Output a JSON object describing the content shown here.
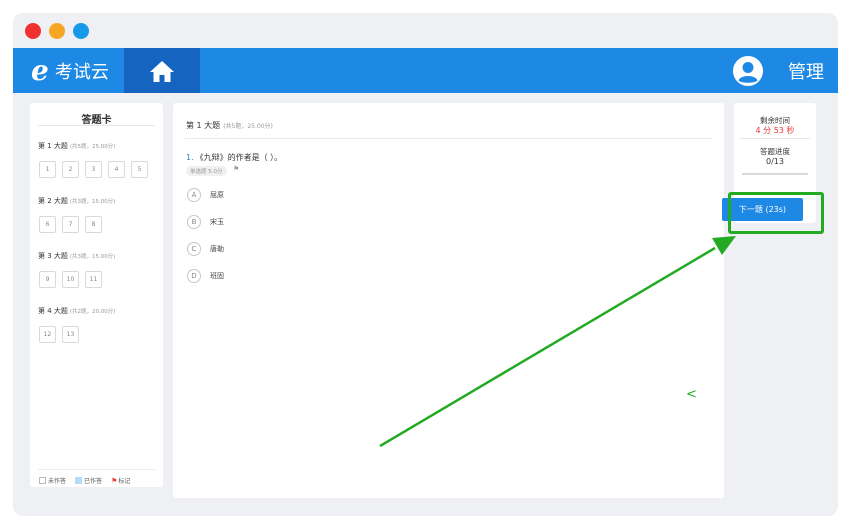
{
  "app": {
    "logo_mark": "e",
    "name": "考试云",
    "manage_label": "管理",
    "home_icon": "home-icon",
    "user_icon": "user-avatar-icon"
  },
  "answer_card": {
    "title": "答题卡",
    "sections": [
      {
        "title": "第 1 大题",
        "sub": "(共5题，25.00分)",
        "questions": [
          "1",
          "2",
          "3",
          "4",
          "5"
        ]
      },
      {
        "title": "第 2 大题",
        "sub": "(共3题，15.00分)",
        "questions": [
          "6",
          "7",
          "8"
        ]
      },
      {
        "title": "第 3 大题",
        "sub": "(共3题，15.00分)",
        "questions": [
          "9",
          "10",
          "11"
        ]
      },
      {
        "title": "第 4 大题",
        "sub": "(共2题，20.00分)",
        "questions": [
          "12",
          "13"
        ]
      }
    ],
    "legend": {
      "undone": "未作答",
      "done": "已作答",
      "flag": "标记"
    }
  },
  "question": {
    "section_title": "第 1 大题",
    "section_sub": "(共5题，25.00分)",
    "number": "1.",
    "text": "《九辩》的作者是（    ）。",
    "tag": "单选题 5.0分",
    "options": [
      {
        "letter": "A",
        "text": "屈原"
      },
      {
        "letter": "B",
        "text": "宋玉"
      },
      {
        "letter": "C",
        "text": "唐勒"
      },
      {
        "letter": "D",
        "text": "班固"
      }
    ]
  },
  "status": {
    "time_label": "剩余时间",
    "time_value": "4 分 53 秒",
    "progress_label": "答题进度",
    "progress_value": "0/13",
    "progress_fraction": 0,
    "next_button": "下一题 (23s)"
  },
  "annotation": {
    "color": "#22aa22",
    "stray_mark": "<"
  }
}
